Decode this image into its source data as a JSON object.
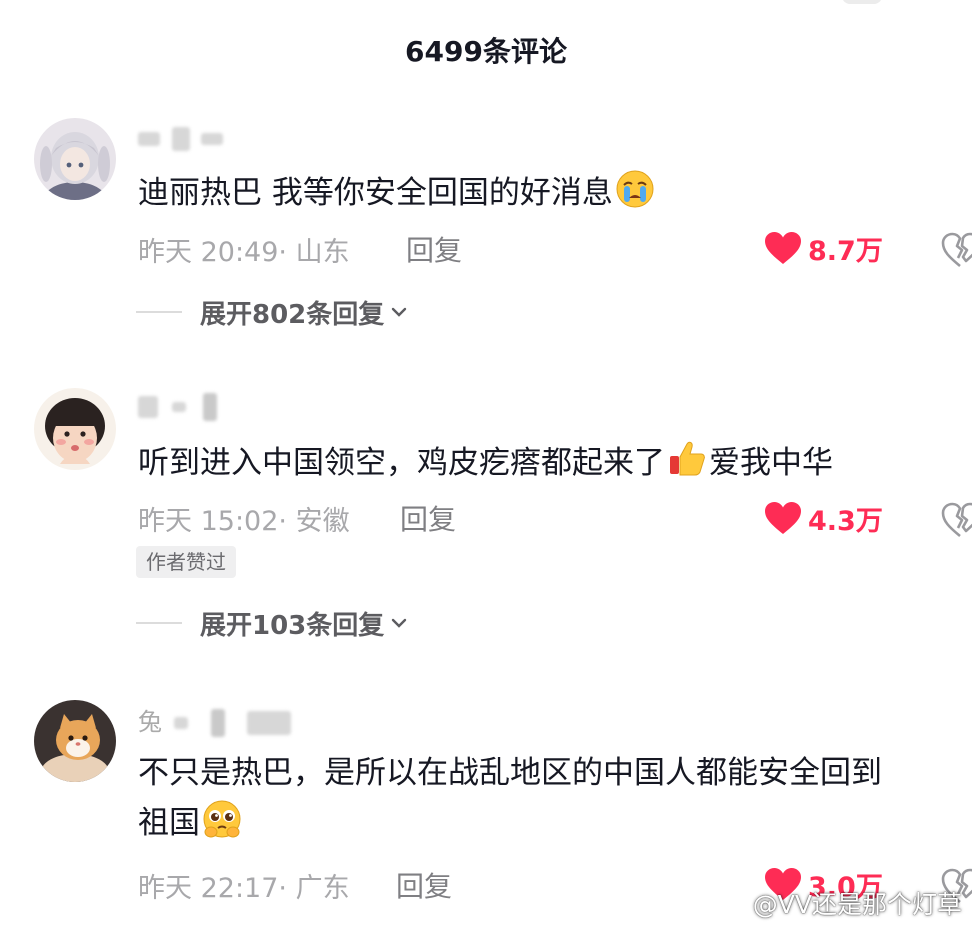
{
  "header": {
    "title": "6499条评论"
  },
  "comments": [
    {
      "username_visible": "",
      "text_parts": [
        "迪丽热巴 我等你安全回国的好消息"
      ],
      "emoji": "crying-face",
      "time": "昨天 20:49",
      "location": "山东",
      "reply_label": "回复",
      "likes": "8.7万",
      "author_liked": "",
      "expand_label": "展开802条回复"
    },
    {
      "username_visible": "",
      "text_before_emoji": "听到进入中国领空，鸡皮疙瘩都起来了",
      "text_after_emoji": "爱我中华",
      "emoji": "thumbs-up",
      "time": "昨天 15:02",
      "location": "安徽",
      "reply_label": "回复",
      "likes": "4.3万",
      "author_liked": "作者赞过",
      "expand_label": "展开103条回复"
    },
    {
      "username_visible": "兔",
      "text_line1": "不只是热巴，是所以在战乱地区的中国人都能安全回到",
      "text_line2": "祖国",
      "emoji": "pleading-face",
      "time": "昨天 22:17",
      "location": "广东",
      "reply_label": "回复",
      "likes": "3.0万"
    }
  ],
  "watermark": {
    "text": "@VV还是那个灯草"
  },
  "colors": {
    "like_red": "#fe2c55",
    "meta_gray": "#a8a8ab",
    "text_dark": "#161823"
  }
}
